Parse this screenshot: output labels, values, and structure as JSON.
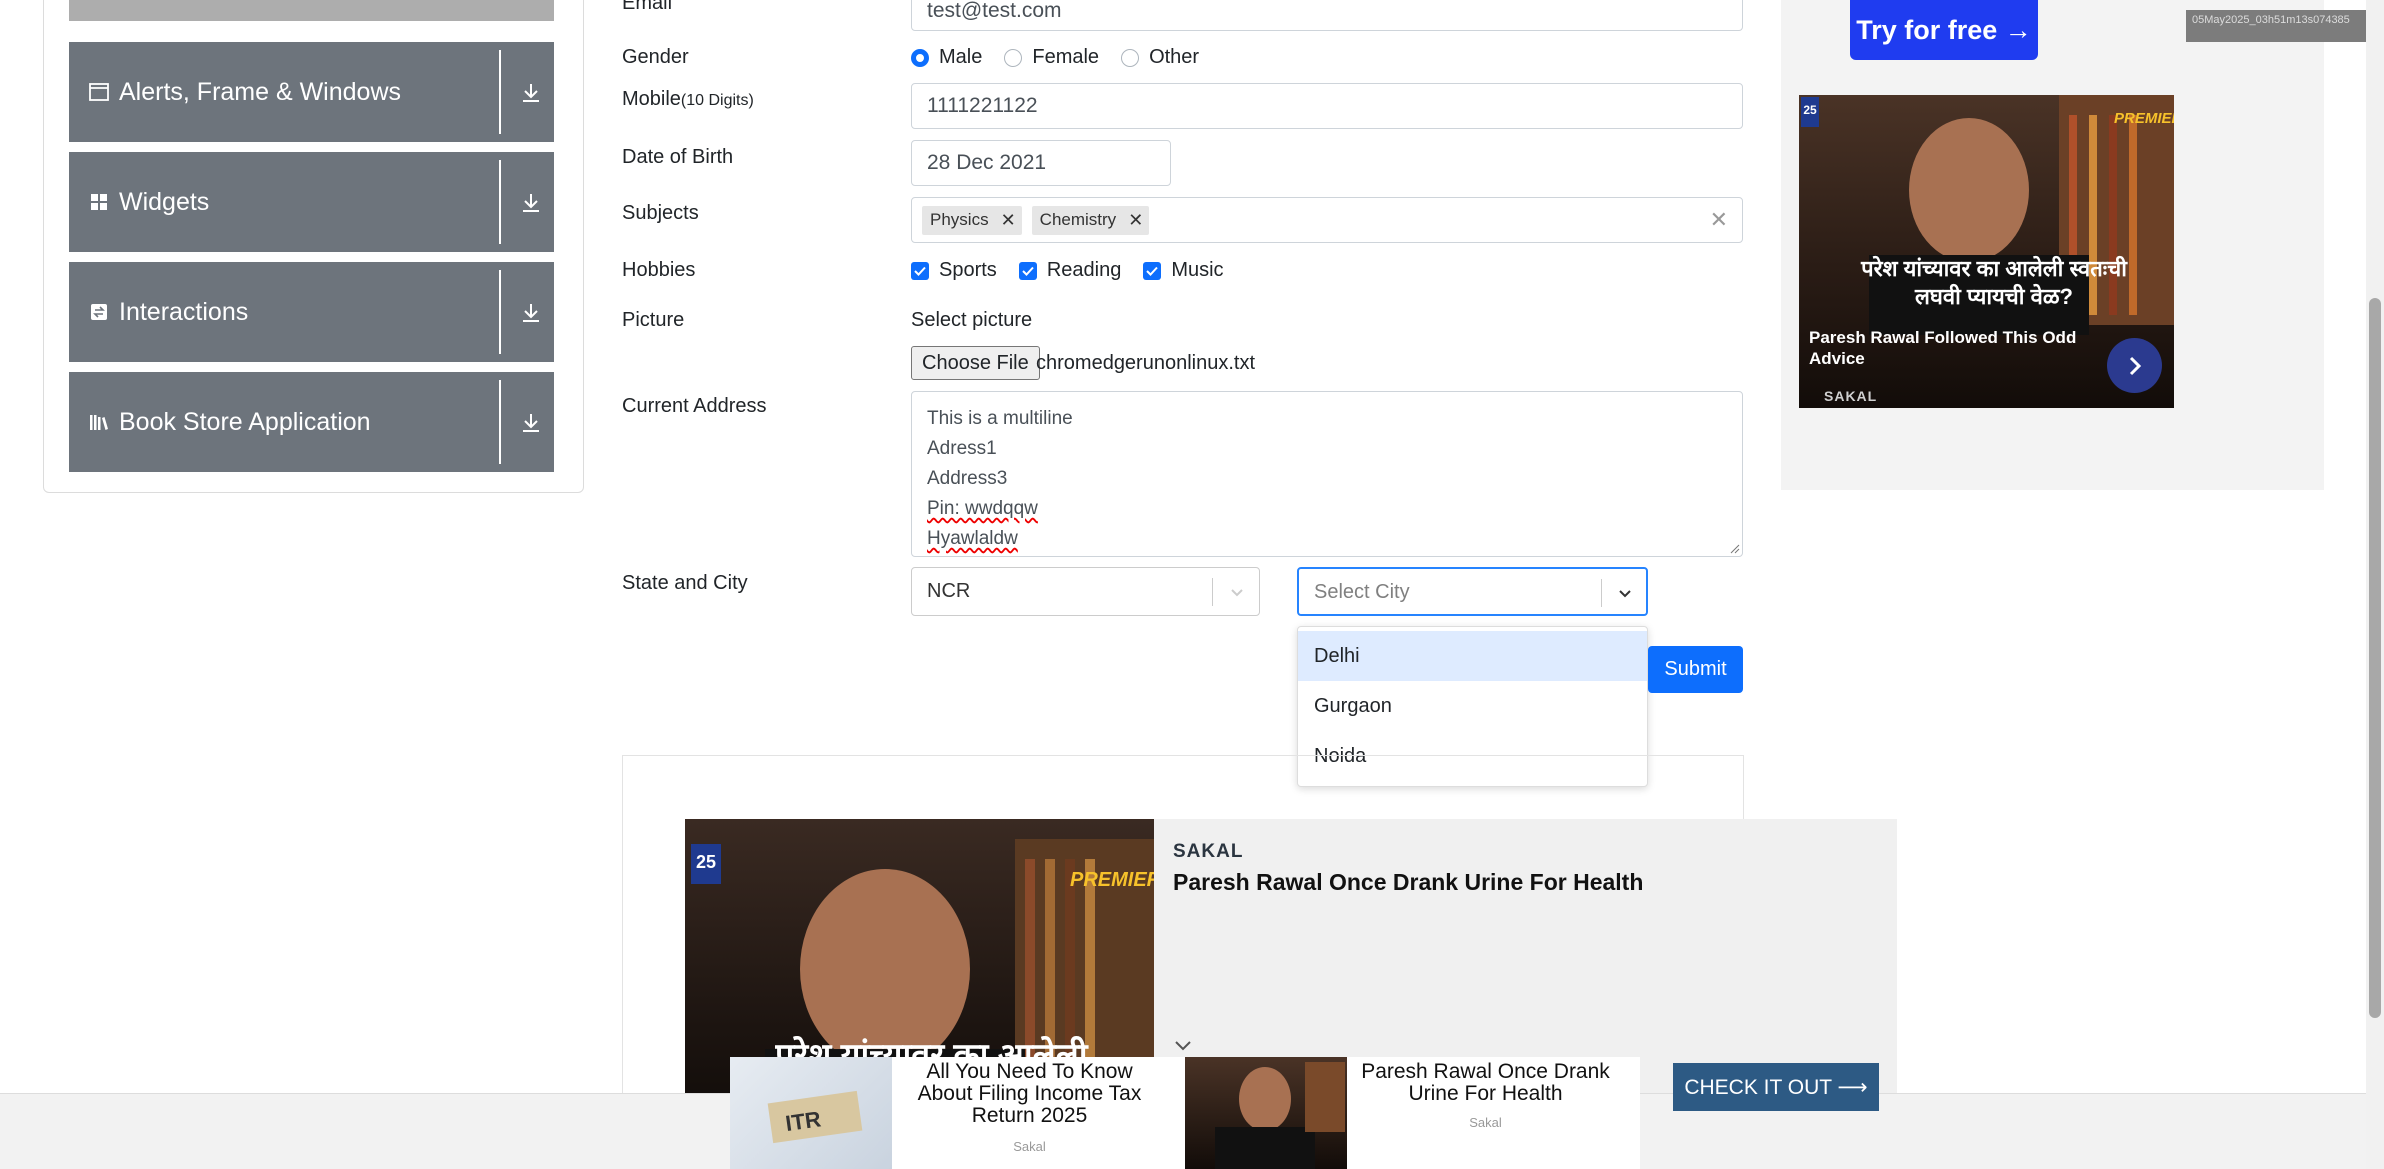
{
  "sidebar": {
    "groups": [
      {
        "label": "Alerts, Frame & Windows",
        "icon": "window-icon"
      },
      {
        "label": "Widgets",
        "icon": "widgets-icon"
      },
      {
        "label": "Interactions",
        "icon": "interactions-icon"
      },
      {
        "label": "Book Store Application",
        "icon": "library-icon"
      }
    ]
  },
  "form": {
    "email_label": "Email",
    "email_value": "test@test.com",
    "gender_label": "Gender",
    "gender_options": [
      "Male",
      "Female",
      "Other"
    ],
    "gender_selected": "Male",
    "mobile_label": "Mobile",
    "mobile_hint": "(10 Digits)",
    "mobile_value": "1111221122",
    "dob_label": "Date of Birth",
    "dob_value": "28 Dec 2021",
    "subjects_label": "Subjects",
    "subjects": [
      "Physics",
      "Chemistry"
    ],
    "hobbies_label": "Hobbies",
    "hobbies": [
      "Sports",
      "Reading",
      "Music"
    ],
    "picture_label": "Picture",
    "picture_hint": "Select picture",
    "file_button": "Choose File",
    "file_name": "chromedgerunonlinux.txt",
    "address_label": "Current Address",
    "address_lines": [
      "This is a multiline",
      "Adress1",
      "Address3",
      "Pin: wwdqqw",
      "Hyawlaldw"
    ],
    "state_city_label": "State and City",
    "state_value": "NCR",
    "city_placeholder": "Select City",
    "city_options": [
      "Delhi",
      "Gurgaon",
      "Noida"
    ],
    "submit_label": "Submit"
  },
  "ads": {
    "right": {
      "cta": "Try for free →",
      "headline": "Paresh Rawal Followed This Odd Advice",
      "image_text": "परेश यांच्यावर का आलेली स्वतःची लघवी प्यायची वेळ?",
      "source": "SAKAL"
    },
    "main": {
      "source": "SAKAL",
      "title": "Paresh Rawal Once Drank Urine For Health",
      "image_text": "परेश यांच्यावर का आलेली"
    },
    "bottom": [
      {
        "title": "All You Need To Know About Filing Income Tax Return 2025",
        "source": "Sakal"
      },
      {
        "title": "Paresh Rawal Once Drank Urine For Health",
        "source": "Sakal"
      }
    ],
    "checkout": "CHECK IT OUT ⟶",
    "badge": "PREMIER",
    "badge_num": "25"
  },
  "stamp": "05May2025_03h51m13s074385"
}
